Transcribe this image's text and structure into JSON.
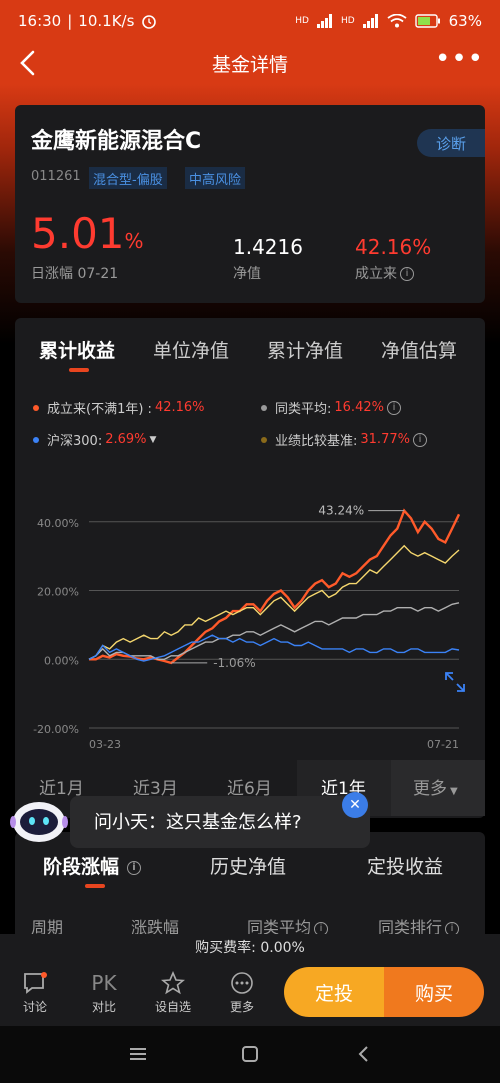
{
  "status": {
    "time": "16:30",
    "speed": "10.1K/s",
    "signal1": "HD",
    "signal2": "HD",
    "battery": "63"
  },
  "nav": {
    "title": "基金详情"
  },
  "fund": {
    "name": "金鹰新能源混合C",
    "diagnose_label": "诊断",
    "code": "011261",
    "tags": [
      "混合型-偏股",
      "中高风险"
    ],
    "daily_change": "5.01",
    "daily_change_unit": "%",
    "daily_label": "日涨幅 07-21",
    "nav_value": "1.4216",
    "nav_label": "净值",
    "since_value": "42.16%",
    "since_label": "成立来"
  },
  "chart_tabs": [
    "累计收益",
    "单位净值",
    "累计净值",
    "净值估算"
  ],
  "legend": [
    {
      "label": "成立来(不满1年) : ",
      "value": "42.16%",
      "color": "#ff5a2a",
      "value_color": "#ff3b30"
    },
    {
      "label": "同类平均: ",
      "value": "16.42%",
      "color": "#9a9a9a",
      "value_color": "#ff3b30"
    },
    {
      "label": "沪深300: ",
      "value": "2.69%",
      "color": "#3b82f6",
      "value_color": "#ff3b30"
    },
    {
      "label": "业绩比较基准: ",
      "value": "31.77%",
      "color": "#8a6a1a",
      "value_color": "#ff3b30"
    }
  ],
  "chart_data": {
    "type": "line",
    "ytick_labels": [
      "40.00%",
      "20.00%",
      "0.00%",
      "-20.00%"
    ],
    "yticks": [
      40,
      20,
      0,
      -20
    ],
    "ylim": [
      -20,
      44
    ],
    "xtick_labels": [
      "03-23",
      "07-21"
    ],
    "annotations": {
      "max_label": "43.24%",
      "max_value": 43.24,
      "min_label": "-1.06%",
      "min_value": -1.06
    },
    "series": [
      {
        "name": "成立来",
        "color": "#ff5a2a",
        "values": [
          0,
          0,
          1,
          0.5,
          1.5,
          1,
          0.8,
          0.2,
          0,
          0.5,
          0,
          -0.5,
          -1.06,
          0.5,
          2,
          4,
          6,
          8,
          9,
          11,
          12,
          14,
          14,
          16,
          16,
          14,
          17,
          19,
          20,
          18,
          15,
          17,
          20,
          22,
          23,
          21,
          22,
          25,
          24,
          25,
          27,
          29,
          30,
          33,
          36,
          38,
          43.24,
          41,
          37,
          40,
          38,
          35,
          34,
          38,
          42.16
        ]
      },
      {
        "name": "业绩比较基准",
        "color": "#f5d76e",
        "values": [
          0,
          1,
          4,
          3,
          5,
          6,
          5,
          6,
          7,
          6,
          6,
          8,
          7,
          8,
          10,
          10,
          12,
          11,
          12,
          13,
          14,
          13,
          14,
          15,
          15,
          13,
          15,
          17,
          18,
          16,
          14,
          16,
          18,
          19,
          20,
          18,
          19,
          21,
          22,
          22,
          24,
          26,
          25,
          27,
          29,
          31,
          33,
          31,
          30,
          31,
          30,
          29,
          28,
          30,
          31.77
        ]
      },
      {
        "name": "同类平均",
        "color": "#b0b0b0",
        "values": [
          0,
          1,
          3,
          1,
          2,
          2,
          1,
          1,
          1,
          1,
          0,
          0,
          1,
          1,
          2,
          3,
          4,
          5,
          5,
          6,
          6,
          7,
          7,
          8,
          8,
          7,
          8,
          9,
          10,
          9,
          8,
          9,
          10,
          11,
          11,
          10,
          11,
          12,
          12,
          12,
          13,
          13,
          13,
          14,
          14,
          15,
          15,
          15,
          14,
          15,
          15,
          14,
          15,
          16,
          16.42
        ]
      },
      {
        "name": "沪深300",
        "color": "#3b82f6",
        "values": [
          0,
          1,
          4,
          2,
          3,
          2,
          1,
          0,
          -0.5,
          0,
          0.5,
          1,
          2,
          3,
          4,
          5,
          5,
          6,
          7,
          6,
          6,
          5,
          6,
          5,
          5,
          4,
          5,
          6,
          5,
          5,
          4,
          4,
          5,
          4,
          3,
          3,
          3,
          3,
          2,
          3,
          3,
          2,
          2,
          3,
          3,
          2,
          2,
          3,
          3,
          2,
          2,
          2,
          2,
          3,
          2.69
        ]
      }
    ]
  },
  "ranges": [
    "近1月",
    "近3月",
    "近6月",
    "近1年",
    "更多"
  ],
  "bottom_tabs": [
    "阶段涨幅",
    "历史净值",
    "定投收益"
  ],
  "columns": [
    "周期",
    "涨跌幅",
    "同类平均",
    "同类排行"
  ],
  "fee": "购买费率:   0.00%",
  "actions": [
    {
      "label": "讨论",
      "icon": "chat-icon"
    },
    {
      "label": "对比",
      "icon": "pk-icon"
    },
    {
      "label": "设自选",
      "icon": "star-icon"
    },
    {
      "label": "更多",
      "icon": "more-icon"
    }
  ],
  "action_icons_text": {
    "pk": "PK"
  },
  "buttons": {
    "dingtou": "定投",
    "buy": "购买"
  },
  "assistant": {
    "text": "问小天：这只基金怎么样?"
  }
}
